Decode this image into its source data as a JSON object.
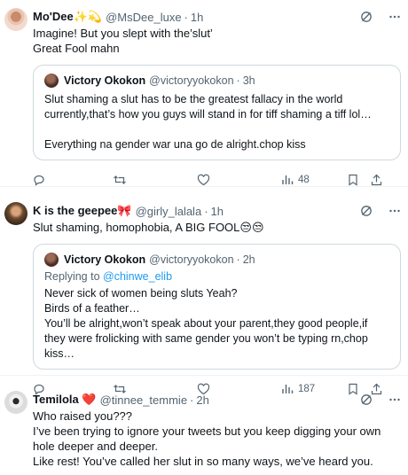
{
  "tweets": [
    {
      "name": "Mo'Dee✨💫",
      "handle": "@MsDee_luxe",
      "time": "1h",
      "text": "Imagine! But you slept with the’slut’\nGreat Fool mahn",
      "quote": {
        "name": "Victory Okokon",
        "handle": "@victoryyokokon",
        "time": "3h",
        "text": "Slut shaming a slut has to be the greatest fallacy in the world currently,that’s how you guys will stand in for tiff shaming a tiff lol…\n\nEverything na gender war una go de alright.chop kiss"
      },
      "views": "48"
    },
    {
      "name": "K is the geepee🎀",
      "handle": "@girly_lalala",
      "time": "1h",
      "text": "Slut shaming, homophobia, A BIG FOOL😒😒",
      "quote": {
        "name": "Victory Okokon",
        "handle": "@victoryyokokon",
        "time": "2h",
        "reply_prefix": "Replying to ",
        "reply_handle": "@chinwe_elib",
        "text": "Never sick of women being sluts Yeah?\nBirds of a feather…\nYou’ll be alright,won’t speak about your parent,they good people,if they were frolicking with same gender you won’t be typing rn,chop kiss…"
      },
      "views": "187"
    },
    {
      "name": "Temilola ❤️",
      "handle": "@tinnee_temmie",
      "time": "2h",
      "text": "Who raised you???\nI’ve been trying to ignore your tweets but you keep digging your own hole deeper and deeper.\nLike rest! You’ve called her slut in so many ways, we’ve heard you."
    }
  ],
  "icons": [
    "grok-icon",
    "more-icon",
    "reply-icon",
    "retweet-icon",
    "like-icon",
    "views-icon",
    "bookmark-icon",
    "share-icon"
  ],
  "colors": {
    "text": "#0f1419",
    "secondary": "#536471",
    "link": "#1d9bf0",
    "border": "#cfd9de"
  }
}
